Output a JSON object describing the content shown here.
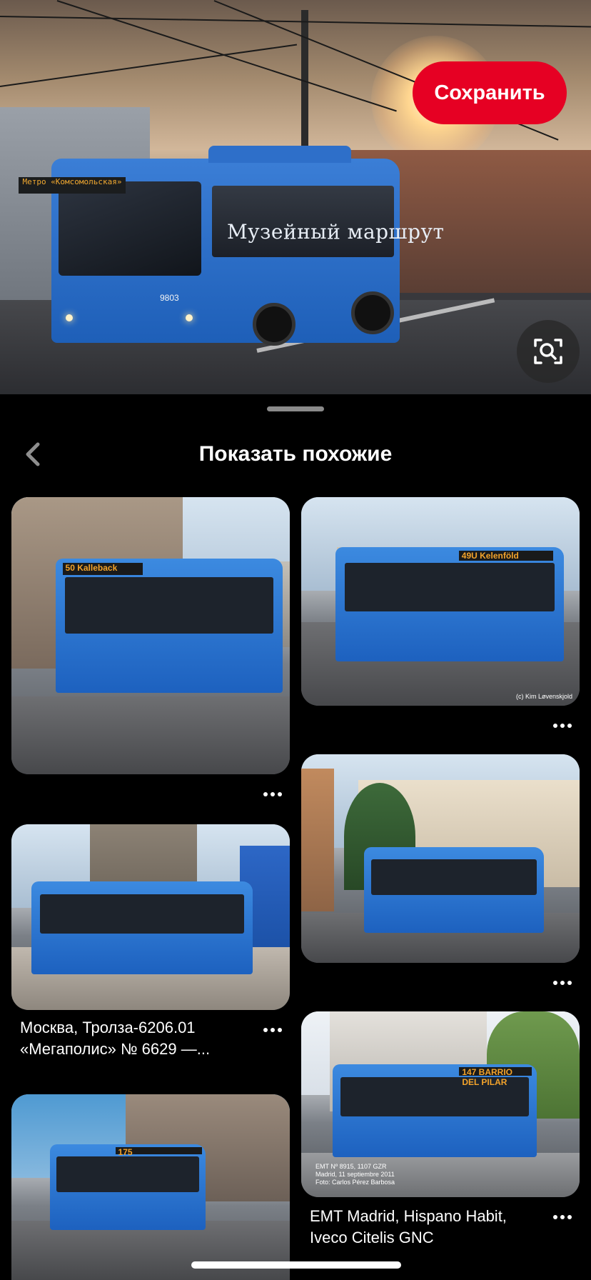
{
  "hero": {
    "save_label": "Сохранить",
    "visual_search_icon": "magnifier-in-frame-icon",
    "bus_sign": "Метро «Комсомольская»",
    "bus_side_text": "Музейный маршрут",
    "bus_number": "9803"
  },
  "sheet": {
    "back_icon": "chevron-left-icon",
    "title": "Показать похожие"
  },
  "pins": [
    {
      "dest": "50  Kalleback",
      "title": "",
      "more_icon": "ellipsis-icon"
    },
    {
      "dest": "49U Kelenföld",
      "credit": "(c) Kim Løvenskjold",
      "title": "",
      "more_icon": "ellipsis-icon"
    },
    {
      "dest": "",
      "title": "",
      "more_icon": "ellipsis-icon"
    },
    {
      "dest": "",
      "title": "Москва, Тролза-6206.01 «Мегаполис» № 6629 —...",
      "more_icon": "ellipsis-icon"
    },
    {
      "dest": "147 BARRIO DEL PILAR",
      "photo_caption": "EMT Nº 8915, 1107 GZR Madrid, 11 septiembre 2011 Foto: Carlos Pérez Barbosa",
      "title": "EMT Madrid, Hispano Habit, Iveco Citelis GNC",
      "more_icon": "ellipsis-icon"
    },
    {
      "dest": "175",
      "title": "",
      "more_icon": "ellipsis-icon"
    }
  ],
  "colors": {
    "accent": "#e60023",
    "background": "#000000"
  }
}
